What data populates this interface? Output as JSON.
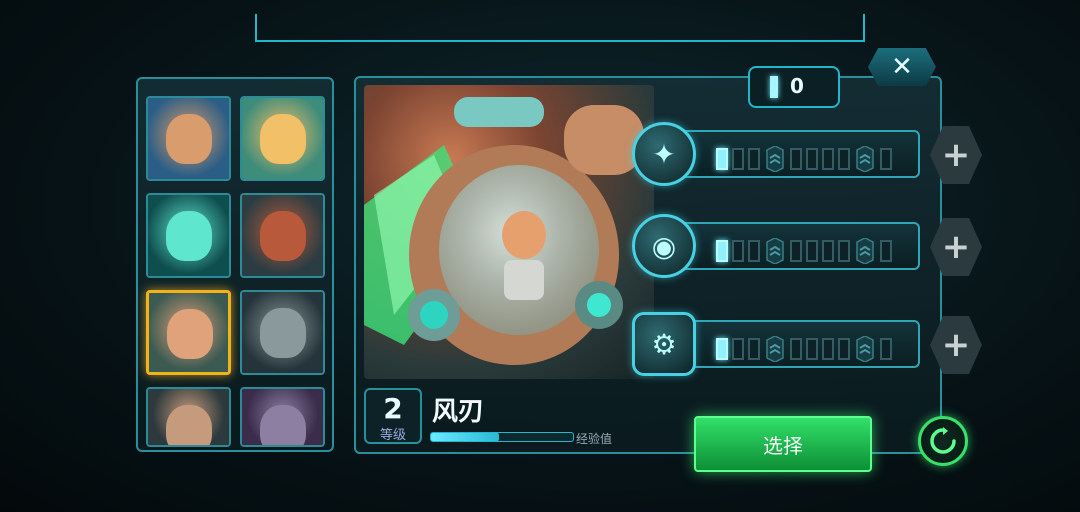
{
  "hero": {
    "name": "风刃",
    "level": "2",
    "level_label": "等级",
    "xp_label": "经验值",
    "xp_progress": 0.48
  },
  "counter": {
    "value": "0"
  },
  "close": {
    "label": "✕"
  },
  "select_button": {
    "label": "选择"
  },
  "skills": [
    {
      "icon": "spirit-beast-icon",
      "level": 1,
      "max": 10
    },
    {
      "icon": "capsule-icon",
      "level": 1,
      "max": 10
    },
    {
      "icon": "mech-robot-icon",
      "level": 1,
      "max": 10
    }
  ],
  "plus_label": "+",
  "roster": [
    {
      "name": "soldier-hero",
      "selected": false,
      "colors": [
        "#2b5e86",
        "#d99c6c"
      ]
    },
    {
      "name": "blonde-hero",
      "selected": false,
      "colors": [
        "#3e8c7a",
        "#f2c067"
      ]
    },
    {
      "name": "spirit-bear",
      "selected": false,
      "colors": [
        "#0f4e4e",
        "#5fe6cf"
      ]
    },
    {
      "name": "red-robot",
      "selected": false,
      "colors": [
        "#2b3d42",
        "#b8593b"
      ]
    },
    {
      "name": "capsule-pilot",
      "selected": true,
      "colors": [
        "#3b5a52",
        "#e0a27a"
      ]
    },
    {
      "name": "gorilla",
      "selected": false,
      "colors": [
        "#24343a",
        "#8a9a9c"
      ]
    },
    {
      "name": "grey-hair-hero",
      "selected": false,
      "colors": [
        "#2d3a3d",
        "#c69a7c"
      ]
    },
    {
      "name": "stone-golem",
      "selected": false,
      "colors": [
        "#3a2c4a",
        "#8c7fa2"
      ]
    }
  ],
  "colors": {
    "accent": "#1fb7c9",
    "select_green": "#32e06a",
    "selected_gold": "#f2b21b"
  }
}
